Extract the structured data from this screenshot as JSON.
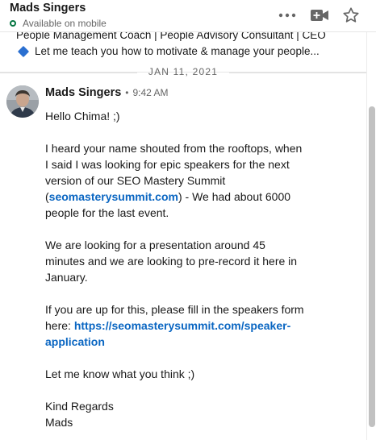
{
  "header": {
    "contact_name": "Mads Singers",
    "presence": "Available on mobile"
  },
  "icons": {
    "more": "more-horizontal-icon",
    "video": "video-call-icon",
    "star": "star-icon"
  },
  "profile": {
    "headline": "People Management Coach | People Advisory Consultant | CEO",
    "teaser": "Let me teach you how to motivate & manage your people..."
  },
  "conversation": {
    "date": "JAN 11, 2021",
    "message": {
      "sender": "Mads Singers",
      "separator": "•",
      "time": "9:42 AM",
      "greeting": "Hello Chima! ;)",
      "p1_line1": "I heard your name shouted from the rooftops, when",
      "p1_line2": "I said I was looking for epic speakers for the next",
      "p1_line3": "version of our SEO Mastery Summit",
      "p1_open": "(",
      "p1_link": "seomasterysummit.com",
      "p1_after": ") - We had about 6000",
      "p1_line5": "people for the last event.",
      "p2_line1": "We are looking for a presentation around 45",
      "p2_line2": "minutes and we are looking to pre-record it here in",
      "p2_line3": "January.",
      "p3_line1": "If you are up for this, please fill in the speakers form",
      "p3_prefix": "here: ",
      "p3_link_a": "https://seomasterysummit.com/speaker-",
      "p3_link_b": "application",
      "p4": "Let me know what you think ;)",
      "closing1": "Kind Regards",
      "closing2": "Mads"
    }
  },
  "colors": {
    "link": "#0a66c2",
    "presence": "#057642",
    "text": "#191919",
    "meta": "#666666"
  }
}
